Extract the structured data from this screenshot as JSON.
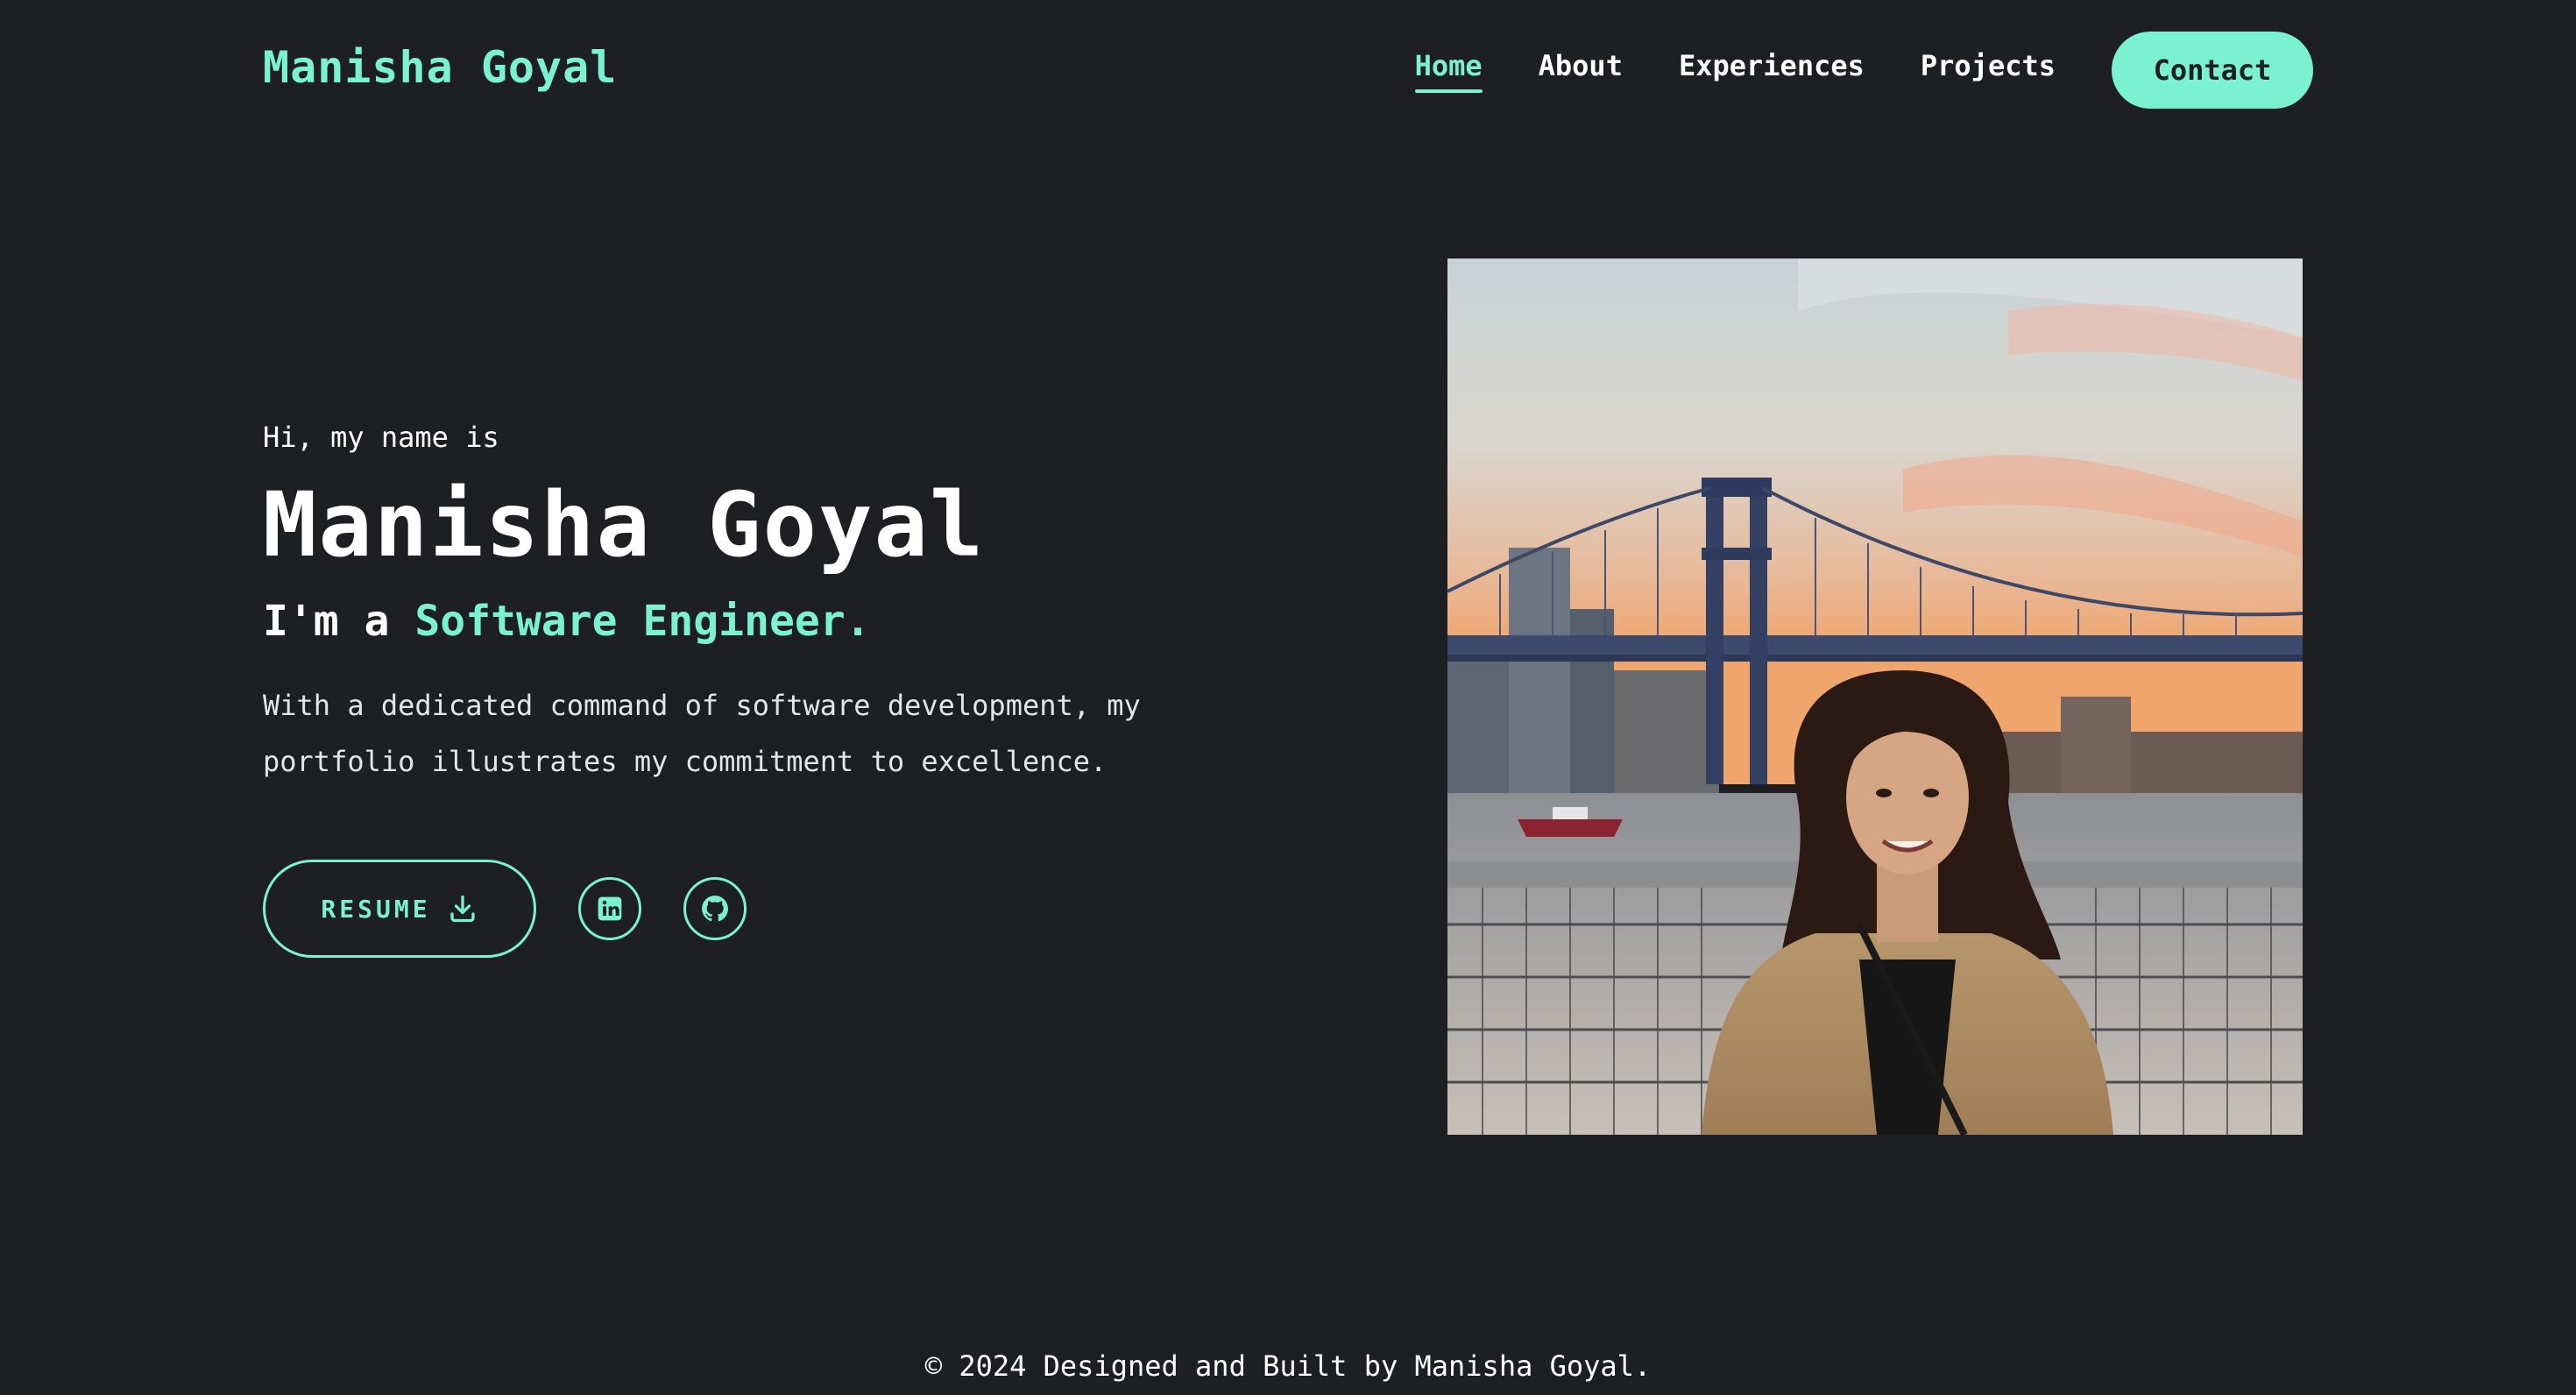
{
  "header": {
    "logo": "Manisha Goyal",
    "nav": [
      {
        "label": "Home",
        "active": true
      },
      {
        "label": "About",
        "active": false
      },
      {
        "label": "Experiences",
        "active": false
      },
      {
        "label": "Projects",
        "active": false
      }
    ],
    "contact_label": "Contact"
  },
  "hero": {
    "greeting": "Hi, my name is",
    "name": "Manisha Goyal",
    "role_prefix": "I'm a ",
    "role_accent": "Software Engineer.",
    "description": "With a dedicated command of software development, my portfolio illustrates my commitment to excellence.",
    "resume_label": "RESUME",
    "resume_icon": "download-icon",
    "social_icons": [
      "linkedin-icon",
      "github-icon"
    ]
  },
  "photo": {
    "subject": "portrait-photo"
  },
  "footer": {
    "text": "© 2024 Designed and Built by Manisha Goyal."
  },
  "colors": {
    "background": "#1d1f22",
    "accent": "#7af2cf",
    "text": "#ffffff"
  }
}
